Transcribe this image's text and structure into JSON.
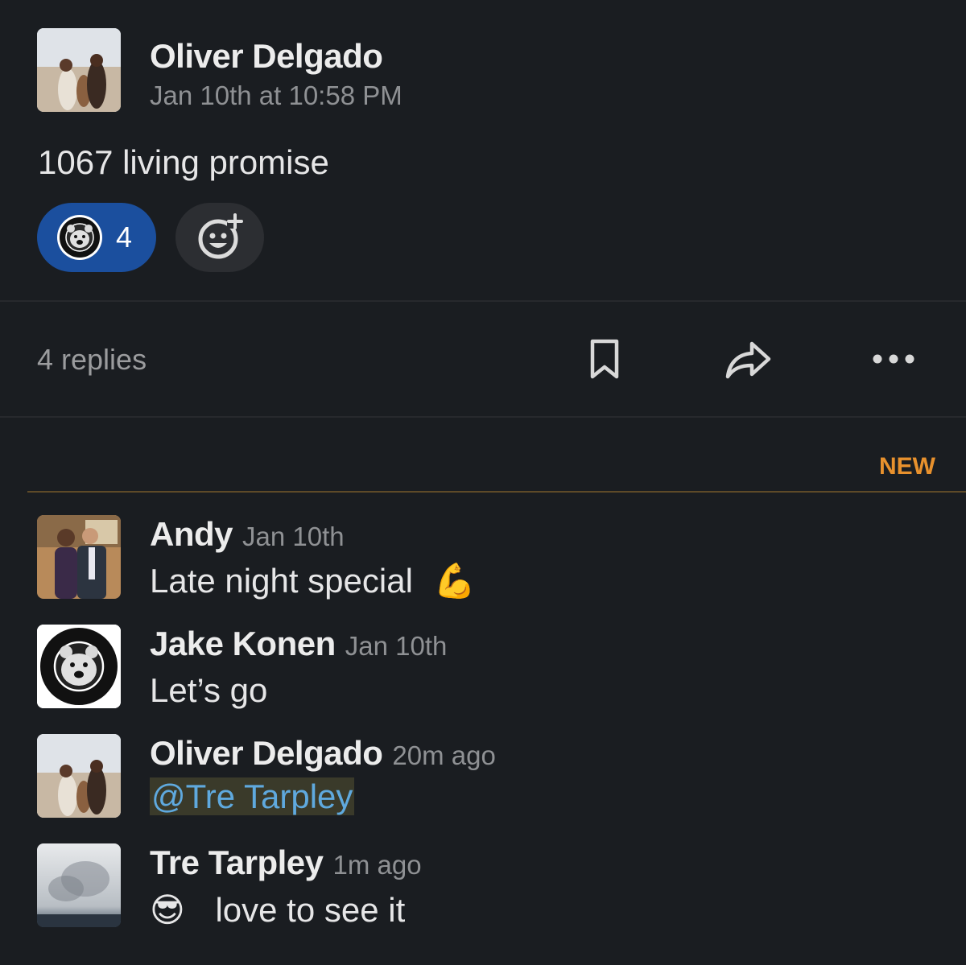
{
  "parent": {
    "author": "Oliver Delgado",
    "timestamp": "Jan 10th at 10:58 PM",
    "text": "1067 living promise",
    "reaction": {
      "emoji": "family-first-life-bear-emoji",
      "count": "4"
    },
    "add_reaction_icon": "add-reaction-icon"
  },
  "thread_bar": {
    "replies_label": "4 replies",
    "icons": [
      "bookmark-icon",
      "share-icon",
      "more-icon"
    ]
  },
  "new_divider": {
    "label": "NEW",
    "color": "#e8912d"
  },
  "replies": [
    {
      "author": "Andy",
      "timestamp": "Jan 10th",
      "text": "Late night special",
      "emoji": "💪"
    },
    {
      "author": "Jake Konen",
      "timestamp": "Jan 10th",
      "text": "Let’s go"
    },
    {
      "author": "Oliver Delgado",
      "timestamp": "20m ago",
      "mention": "@Tre Tarpley"
    },
    {
      "author": "Tre Tarpley",
      "timestamp": "1m ago",
      "emoji": "😎",
      "text": "love to see it"
    }
  ],
  "colors": {
    "background": "#1a1d21",
    "reaction_pill": "#1b4f9e",
    "mention": "#5fa9de"
  }
}
